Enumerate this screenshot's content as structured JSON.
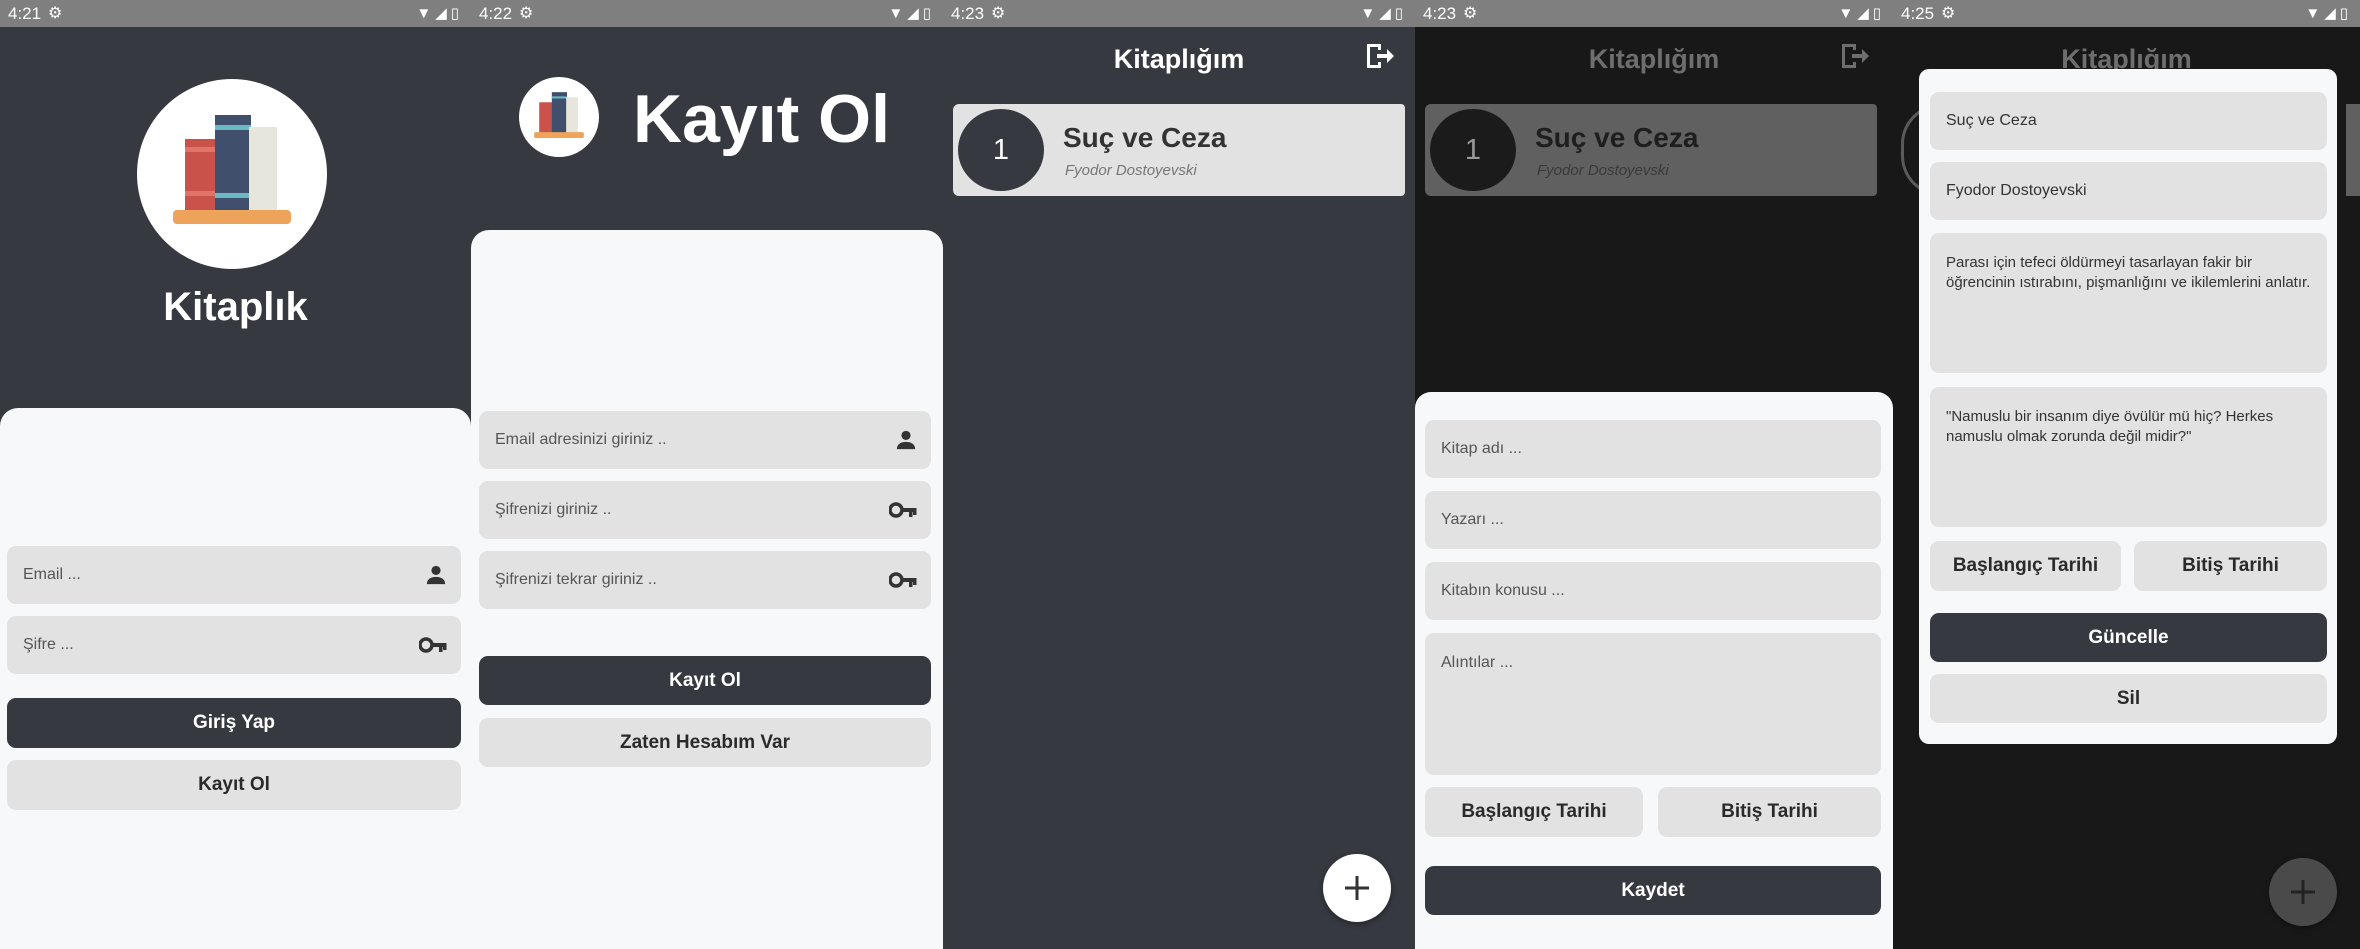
{
  "screens": [
    {
      "status_time": "4:21",
      "app_title": "Kitaplık",
      "email_placeholder": "Email ...",
      "password_placeholder": "Şifre ...",
      "login_button": "Giriş Yap",
      "register_button": "Kayıt Ol"
    },
    {
      "status_time": "4:22",
      "title": "Kayıt Ol",
      "email_placeholder": "Email adresinizi giriniz ..",
      "password_placeholder": "Şifrenizi giriniz ..",
      "password_repeat_placeholder": "Şifrenizi tekrar giriniz ..",
      "register_button": "Kayıt Ol",
      "have_account_button": "Zaten Hesabım Var"
    },
    {
      "status_time": "4:23",
      "title": "Kitaplığım",
      "books": [
        {
          "number": "1",
          "title": "Suç ve Ceza",
          "author": "Fyodor Dostoyevski"
        }
      ],
      "fab_label": "+"
    },
    {
      "status_time": "4:23",
      "title": "Kitaplığım",
      "books": [
        {
          "number": "1",
          "title": "Suç ve Ceza",
          "author": "Fyodor Dostoyevski"
        }
      ],
      "form": {
        "title_placeholder": "Kitap adı ...",
        "author_placeholder": "Yazarı ...",
        "topic_placeholder": "Kitabın konusu ...",
        "quotes_placeholder": "Alıntılar ...",
        "start_date_button": "Başlangıç Tarihi",
        "end_date_button": "Bitiş Tarihi",
        "save_button": "Kaydet"
      }
    },
    {
      "status_time": "4:25",
      "title": "Kitaplığım",
      "fab_label": "+",
      "form": {
        "title_value": "Suç ve Ceza",
        "author_value": "Fyodor Dostoyevski",
        "topic_value": "Parası için tefeci öldürmeyi tasarlayan fakir bir öğrencinin ıstırabını, pişmanlığını ve ikilemlerini anlatır.",
        "quote_value": "\"Namuslu bir insanım diye övülür mü hiç? Herkes namuslu olmak zorunda değil midir?\"",
        "start_date_button": "Başlangıç Tarihi",
        "end_date_button": "Bitiş Tarihi",
        "update_button": "Güncelle",
        "delete_button": "Sil"
      }
    }
  ],
  "colors": {
    "dark": "#363a40",
    "field": "#e2e2e2",
    "sheet": "#f7f8fa",
    "status_bar": "#7f7f7f"
  },
  "icons": {
    "settings": "gear-icon",
    "wifi": "wifi-icon",
    "signal": "signal-icon",
    "battery": "battery-icon",
    "user": "person-icon",
    "password": "key-icon",
    "logout": "logout-icon",
    "add": "plus-icon",
    "logo": "books-logo-icon"
  }
}
